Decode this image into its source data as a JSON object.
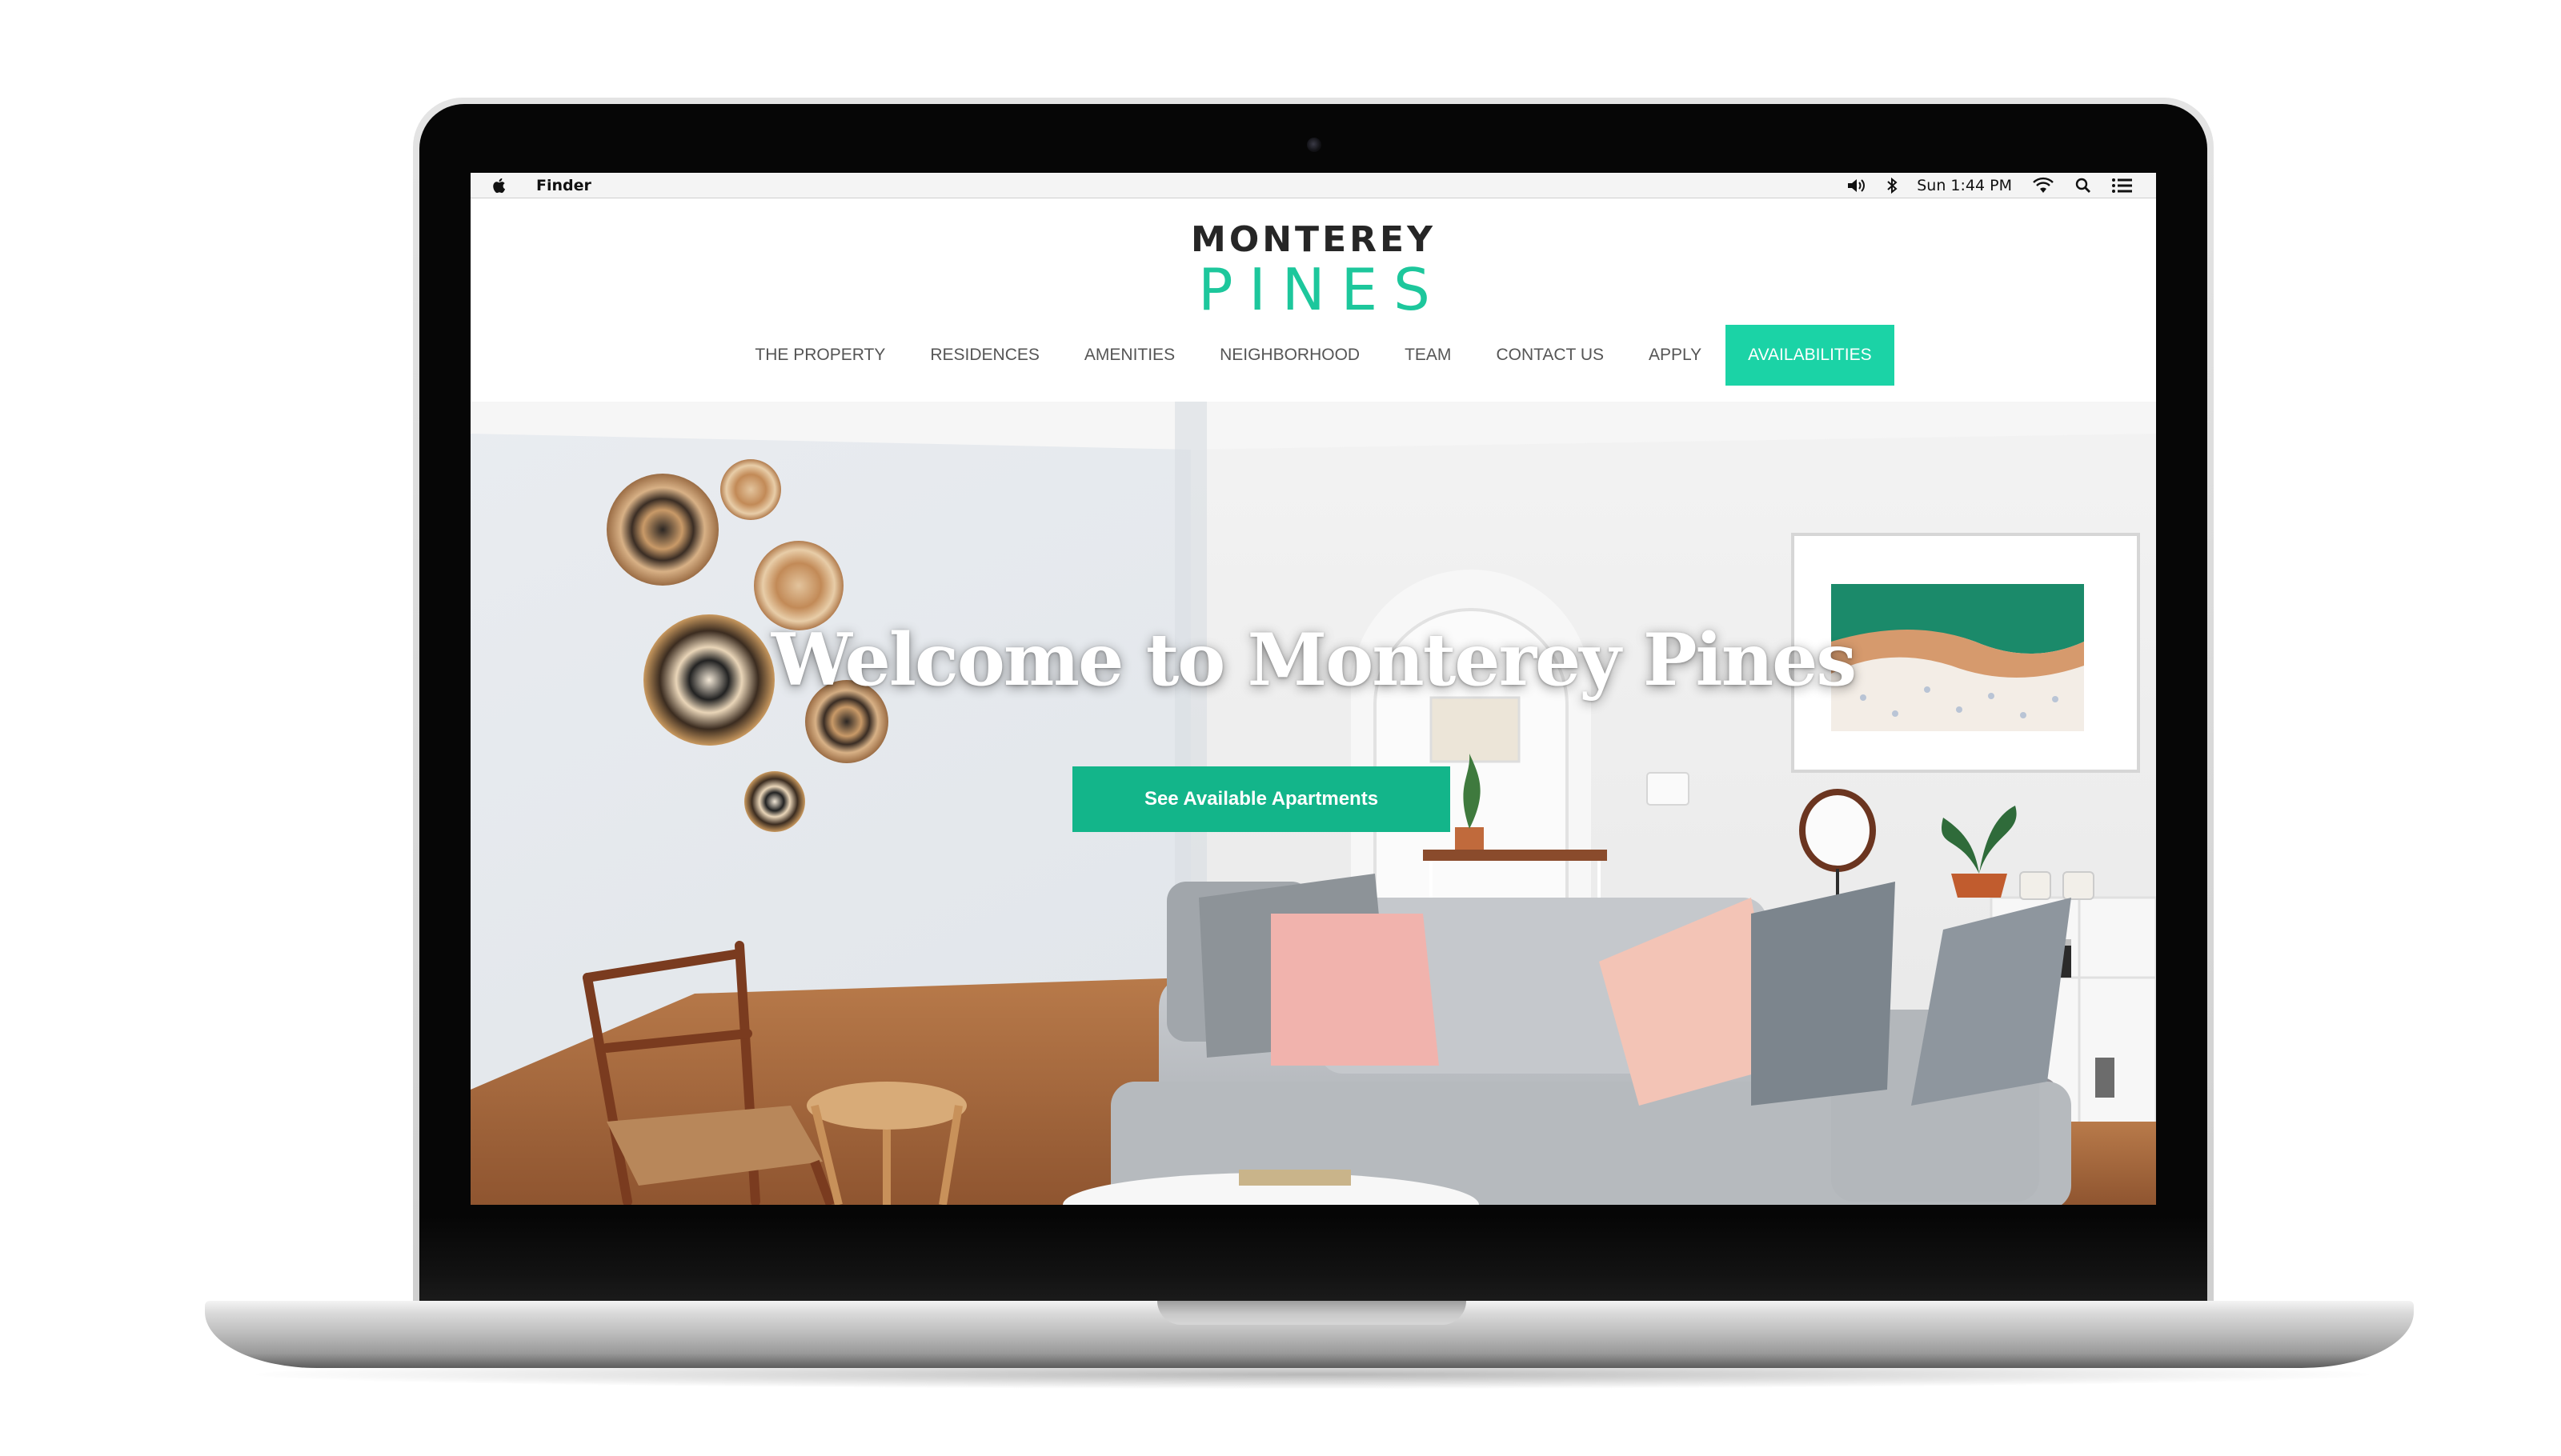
{
  "menubar": {
    "app_name": "Finder",
    "clock": "Sun 1:44 PM",
    "icons": [
      "apple-icon",
      "volume-icon",
      "bluetooth-icon",
      "wifi-icon",
      "spotlight-search-icon",
      "notification-center-icon"
    ]
  },
  "site": {
    "logo": {
      "line1": "MONTEREY",
      "line2": "PINES"
    },
    "nav": [
      "THE PROPERTY",
      "RESIDENCES",
      "AMENITIES",
      "NEIGHBORHOOD",
      "TEAM",
      "CONTACT US",
      "APPLY",
      "AVAILABILITIES"
    ],
    "hero": {
      "title": "Welcome to Monterey Pines",
      "button": "See Available Apartments"
    }
  },
  "colors": {
    "accent_green": "#1bd3a6",
    "button_green": "#13b58a",
    "logo_dark": "#262626",
    "logo_green": "#1dc79c"
  }
}
